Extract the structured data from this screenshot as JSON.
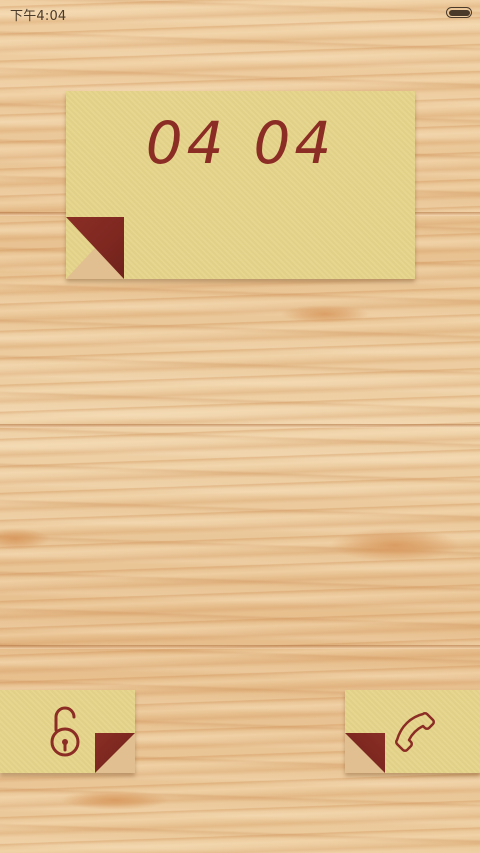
{
  "status_bar": {
    "time": "下午4:04",
    "battery_icon": "battery-icon"
  },
  "clock": {
    "hours": "04",
    "minutes": "04"
  },
  "actions": {
    "unlock_icon": "unlock-padlock-icon",
    "phone_icon": "phone-handset-icon"
  },
  "colors": {
    "note_paper": "#e5d48a",
    "ink": "#8b2c25",
    "fold": "#7d2720",
    "wood": "#e9c697"
  }
}
